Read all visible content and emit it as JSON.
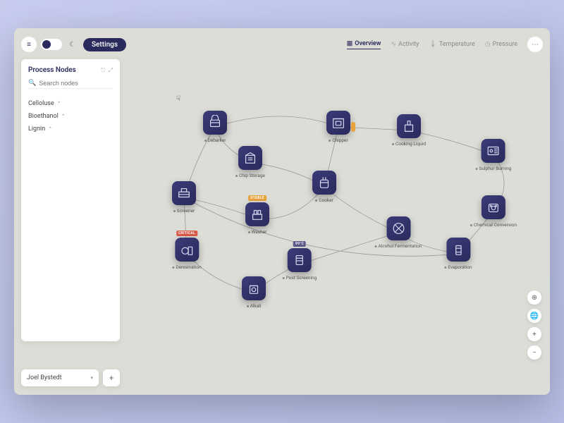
{
  "colors": {
    "accent": "#2a2a5c",
    "warn": "#e8a23c",
    "danger": "#d85a4a"
  },
  "topbar": {
    "settings_label": "Settings",
    "tabs": [
      {
        "label": "Overview",
        "icon": "grid",
        "active": true
      },
      {
        "label": "Activity",
        "icon": "pulse",
        "active": false
      },
      {
        "label": "Temperature",
        "icon": "thermo",
        "active": false
      },
      {
        "label": "Pressure",
        "icon": "gauge",
        "active": false
      }
    ]
  },
  "sidebar": {
    "title": "Process Nodes",
    "search_placeholder": "Search nodes",
    "categories": [
      {
        "label": "Celloluse",
        "expanded": false
      },
      {
        "label": "Bioethanol",
        "expanded": false
      },
      {
        "label": "Lignin",
        "expanded": false
      }
    ]
  },
  "user": {
    "name": "Joel Bystedt"
  },
  "zoom": {
    "plus": "+",
    "minus": "−"
  },
  "nodes": {
    "debarker": "Debarker",
    "chipper": "Chipper",
    "cooking_liquid": "Cooking Liquid",
    "sulphur_burning": "Sulphur Burning",
    "chip_storage": "Chip Storage",
    "screener": "Screener",
    "cooker": "Cooker",
    "chemical_conversion": "Chemical Conversion",
    "washer": "Washer",
    "alcohol_fermentation": "Alcohol Fermentation",
    "evaporation": "Evaporation",
    "deresination": "Deresination",
    "post_screening": "Post Screening",
    "alkali": "Alkali"
  },
  "badges": {
    "washer": "STABLE",
    "deresination": "CRITICAL",
    "post_screening": "99°C"
  }
}
